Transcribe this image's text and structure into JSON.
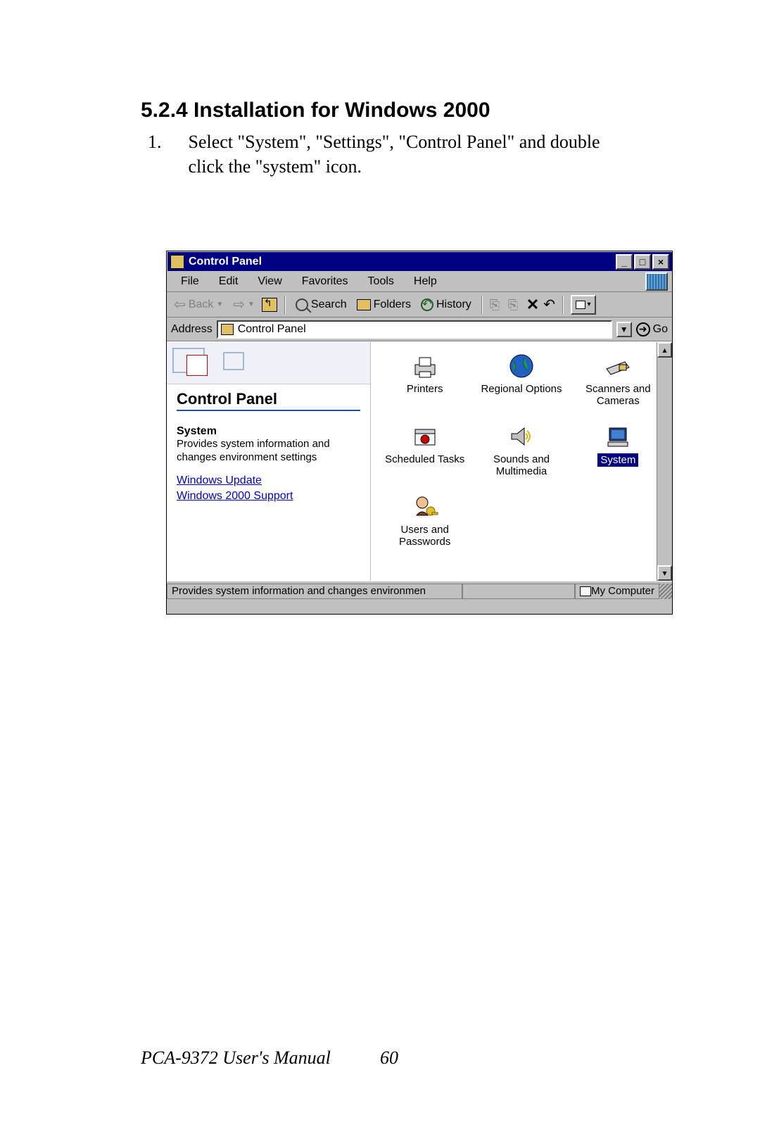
{
  "doc": {
    "heading": "5.2.4 Installation for Windows 2000",
    "step_num": "1.",
    "step_text": "Select \"System\", \"Settings\", \"Control Panel\" and double click the \"system\" icon.",
    "footer_left": "PCA-9372 User's Manual",
    "footer_page": "60"
  },
  "win": {
    "title": "Control Panel",
    "menus": [
      "File",
      "Edit",
      "View",
      "Favorites",
      "Tools",
      "Help"
    ],
    "toolbar": {
      "back": "Back",
      "search": "Search",
      "folders": "Folders",
      "history": "History"
    },
    "address_label": "Address",
    "address_value": "Control Panel",
    "go": "Go",
    "left": {
      "title": "Control Panel",
      "item_name": "System",
      "item_desc": "Provides system information and changes environment settings",
      "link1": "Windows Update",
      "link2": "Windows 2000 Support"
    },
    "icons": [
      {
        "label": "Printers"
      },
      {
        "label": "Regional Options"
      },
      {
        "label": "Scanners and Cameras"
      },
      {
        "label": "Scheduled Tasks"
      },
      {
        "label": "Sounds and Multimedia"
      },
      {
        "label": "System",
        "selected": true
      },
      {
        "label": "Users and Passwords"
      }
    ],
    "status_left": "Provides system information and changes environmen",
    "status_right": "My Computer"
  }
}
